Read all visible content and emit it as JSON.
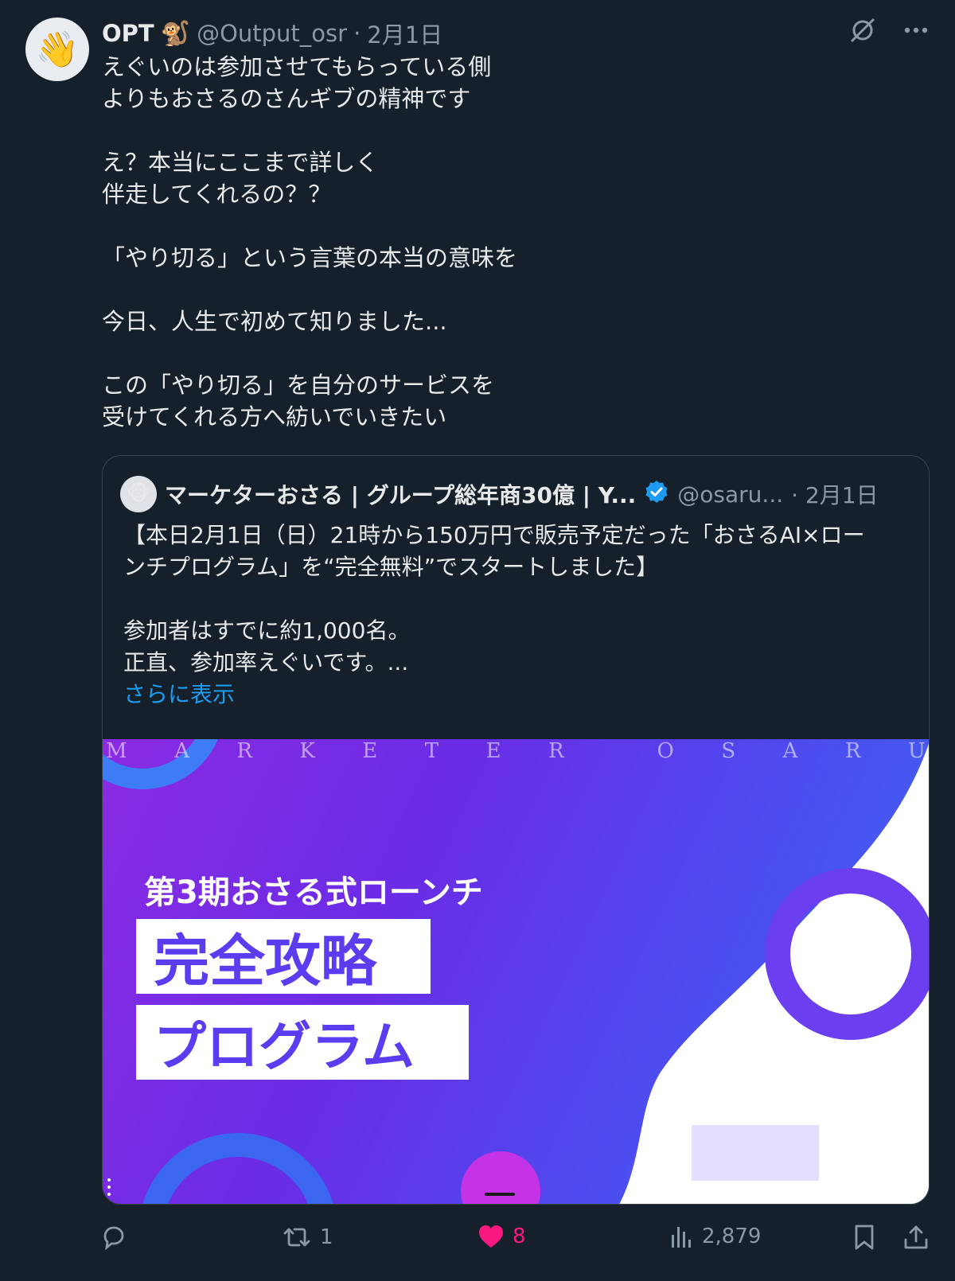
{
  "post": {
    "avatar_emoji": "👋",
    "name": "OPT",
    "name_emoji": "🐒",
    "handle": "@Output_osr",
    "separator": "·",
    "date": "2月1日",
    "lines": [
      "えぐいのは参加させてもらっている側",
      "よりもおさるのさんギブの精神です",
      "",
      "え？本当にここまで詳しく",
      "伴走してくれるの？？",
      "",
      "「やり切る」という言葉の本当の意味を",
      "",
      "今日、人生で初めて知りました...",
      "",
      "この「やり切る」を自分のサービスを",
      "受けてくれる方へ紡いでいきたい"
    ]
  },
  "quote": {
    "avatar_emoji": "🐵",
    "name": "マーケターおさる | グループ総年商30億 | Y...",
    "handle": "@osaru...",
    "date": "· 2月1日",
    "lines": [
      "【本日2月1日（日）21時から150万円で販売予定だった「おさるAI×ロー",
      "ンチプログラム」を“完全無料”でスタートしました】",
      "",
      "参加者はすでに約1,000名。",
      "正直、参加率えぐいです。..."
    ],
    "show_more": "さらに表示",
    "media": {
      "letters": [
        "M",
        "A",
        "R",
        "K",
        "E",
        "T",
        "E",
        "R",
        "",
        "O",
        "S",
        "A",
        "R",
        "U"
      ],
      "title": "第3期おさる式ローンチ",
      "box1": "完全攻略",
      "box2": "プログラム"
    }
  },
  "actions": {
    "reply_count": "",
    "repost_count": "1",
    "like_count": "8",
    "views_count": "2,879"
  },
  "colors": {
    "background": "#15202b",
    "text": "#e7e9ea",
    "muted": "#8b98a5",
    "link": "#1d9bf0",
    "like": "#f91880",
    "border": "#38444d"
  }
}
